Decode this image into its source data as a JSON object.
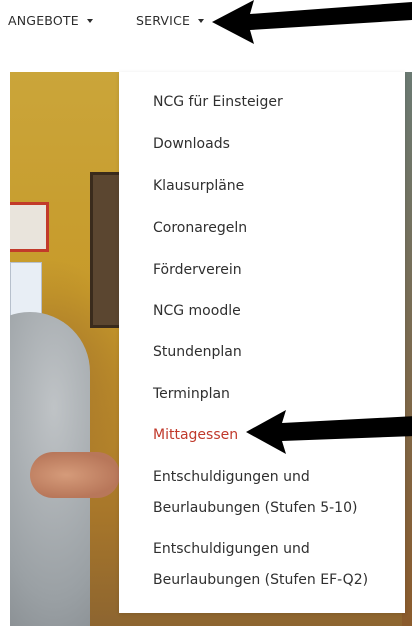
{
  "nav": {
    "angebote": "ANGEBOTE",
    "service": "SERVICE"
  },
  "dropdown": {
    "items": [
      "NCG für Einsteiger",
      "Downloads",
      "Klausurpläne",
      "Coronaregeln",
      "Förderverein",
      "NCG moodle",
      "Stundenplan",
      "Terminplan",
      "Mittagessen",
      "Entschuldigungen und",
      "Beurlaubungen (Stufen 5-10)",
      "Entschuldigungen und",
      "Beurlaubungen (Stufen EF-Q2)"
    ],
    "active_item": "Mittagessen"
  },
  "colors": {
    "active": "#c0392b",
    "text": "#2f2f2f",
    "arrow": "#000000"
  }
}
